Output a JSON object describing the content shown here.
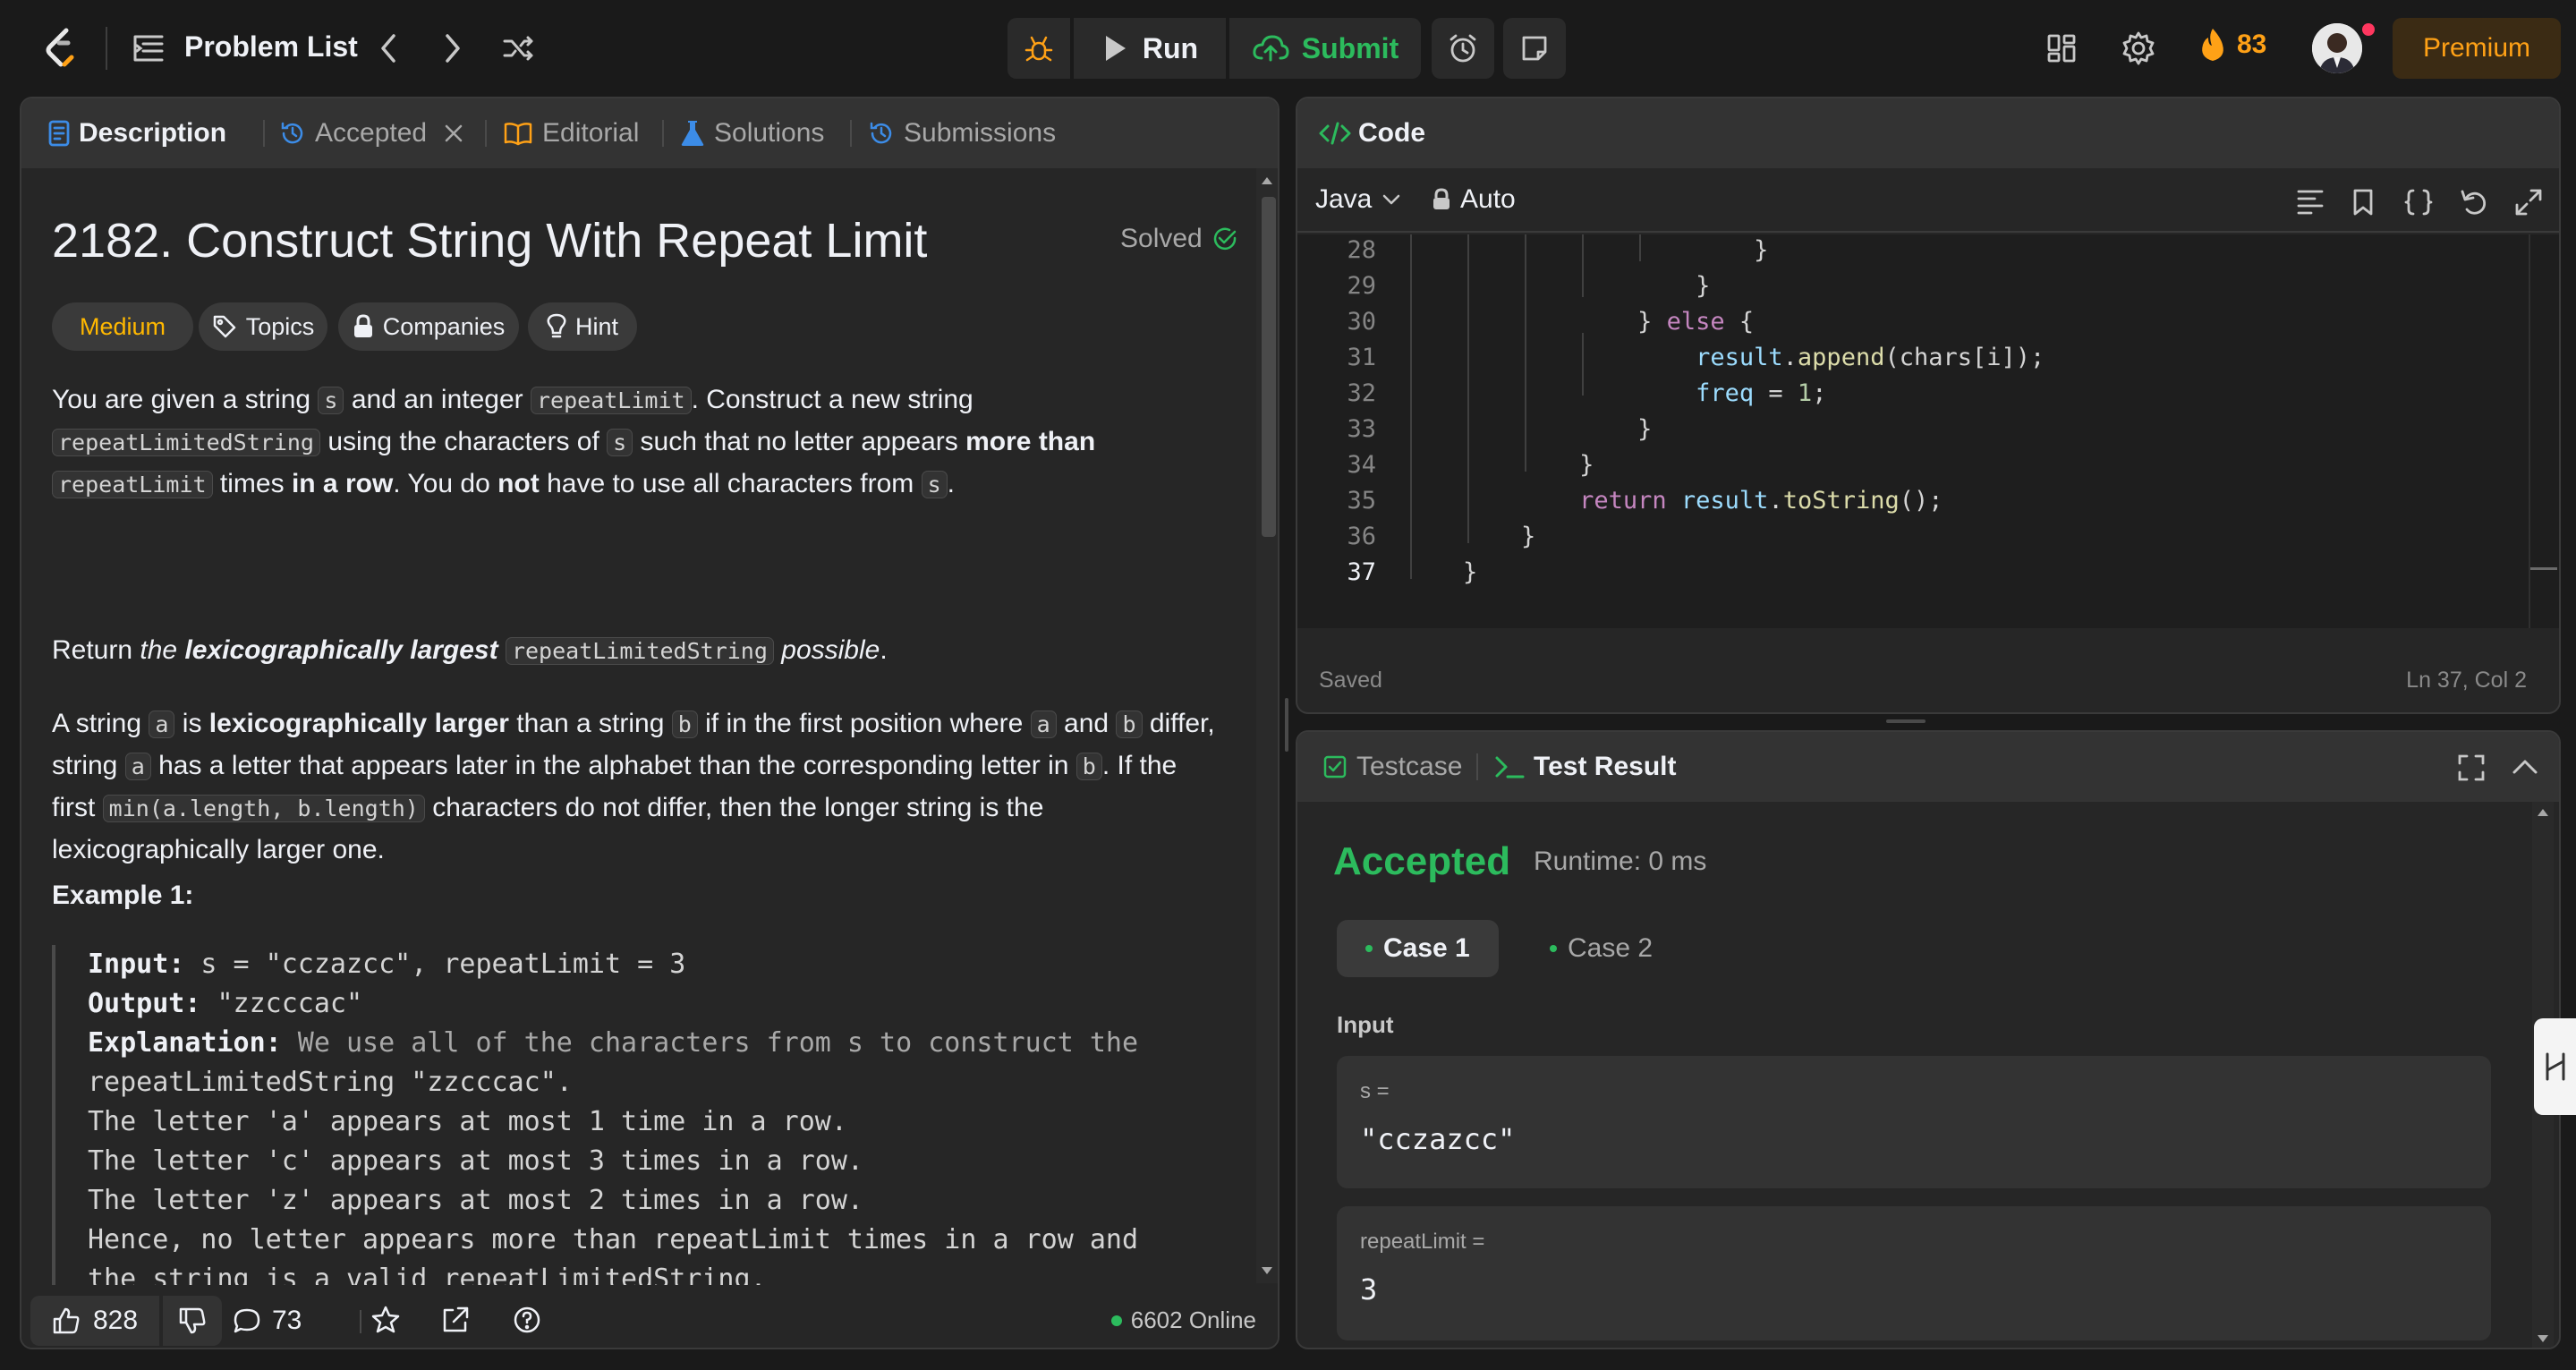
{
  "topbar": {
    "problem_list_label": "Problem List",
    "run_label": "Run",
    "submit_label": "Submit",
    "streak_count": "83",
    "premium_label": "Premium",
    "colors": {
      "brand": "#ffa116",
      "submit": "#2cbb5d",
      "bg": "#1a1a1a"
    },
    "icons": [
      "logo-icon",
      "list-icon",
      "chevron-left-icon",
      "chevron-right-icon",
      "shuffle-icon",
      "debug-icon",
      "play-icon",
      "cloud-upload-icon",
      "alarm-icon",
      "note-icon",
      "layout-icon",
      "gear-icon",
      "fire-icon",
      "avatar"
    ]
  },
  "left_tabs": [
    {
      "label": "Description",
      "icon": "document-icon"
    },
    {
      "label": "Accepted",
      "icon": "history-icon"
    },
    {
      "label": "Editorial",
      "icon": "book-icon"
    },
    {
      "label": "Solutions",
      "icon": "flask-icon"
    },
    {
      "label": "Submissions",
      "icon": "history-icon"
    }
  ],
  "problem": {
    "title": "2182. Construct String With Repeat Limit",
    "status": "Solved",
    "difficulty": "Medium",
    "tags": [
      "Topics",
      "Companies",
      "Hint"
    ],
    "p1": {
      "t1": "You are given a string ",
      "c1": "s",
      "t2": " and an integer ",
      "c2": "repeatLimit",
      "t3": ". Construct a new string ",
      "c3": "repeatLimitedString",
      "t4": " using the characters of ",
      "c4": "s",
      "t5": " such that no letter appears ",
      "b1": "more than",
      "t6": " ",
      "c5": "repeatLimit",
      "t7": " times ",
      "b2": "in a row",
      "t8": ". You do ",
      "b3": "not",
      "t9": " have to use all characters from ",
      "c6": "s",
      "t10": "."
    },
    "p2": {
      "t1": "Return ",
      "i1": "the ",
      "bi1": "lexicographically largest",
      "t2": " ",
      "c1": "repeatLimitedString",
      "i2": " possible",
      "t3": "."
    },
    "p3": {
      "t1": "A string ",
      "c1": "a",
      "t2": " is ",
      "b1": "lexicographically larger",
      "t3": " than a string ",
      "c2": "b",
      "t4": " if in the first position where ",
      "c3": "a",
      "t5": " and ",
      "c4": "b",
      "t6": " differ, string ",
      "c5": "a",
      "t7": " has a letter that appears later in the alphabet than the corresponding letter in ",
      "c6": "b",
      "t8": ". If the first ",
      "c7": "min(a.length, b.length)",
      "t9": " characters do not differ, then the longer string is the lexicographically larger one."
    },
    "example_title": "Example 1:",
    "example": {
      "input_key": "Input:",
      "input_val": " s = \"cczazcc\", repeatLimit = 3",
      "output_key": "Output:",
      "output_val": " \"zzcccac\"",
      "expl_key": "Explanation:",
      "expl_val": " We use all of the characters from s to construct the",
      "lines": [
        "repeatLimitedString \"zzcccac\".",
        "The letter 'a' appears at most 1 time in a row.",
        "The letter 'c' appears at most 3 times in a row.",
        "The letter 'z' appears at most 2 times in a row.",
        "Hence, no letter appears more than repeatLimit times in a row and",
        "the string is a valid repeatLimitedString."
      ]
    }
  },
  "footer": {
    "likes": "828",
    "comments": "73",
    "online": "6602 Online"
  },
  "code_panel": {
    "tab_label": "Code",
    "language": "Java",
    "mode": "Auto",
    "saved_label": "Saved",
    "cursor_position": "Ln 37, Col 2",
    "lines": [
      {
        "n": "28",
        "segs": [
          [
            "",
            "                        }"
          ]
        ]
      },
      {
        "n": "29",
        "segs": [
          [
            "",
            "                    }"
          ]
        ]
      },
      {
        "n": "30",
        "segs": [
          [
            "",
            "                } "
          ],
          [
            "kw",
            "else"
          ],
          [
            "",
            " {"
          ]
        ]
      },
      {
        "n": "31",
        "segs": [
          [
            "",
            "                    "
          ],
          [
            "vr",
            "result"
          ],
          [
            "",
            "."
          ],
          [
            "fn",
            "append"
          ],
          [
            "",
            "(chars[i]);"
          ]
        ]
      },
      {
        "n": "32",
        "segs": [
          [
            "",
            "                    "
          ],
          [
            "vr",
            "freq"
          ],
          [
            "",
            " = "
          ],
          [
            "nm",
            "1"
          ],
          [
            "",
            ";"
          ]
        ]
      },
      {
        "n": "33",
        "segs": [
          [
            "",
            "                }"
          ]
        ]
      },
      {
        "n": "34",
        "segs": [
          [
            "",
            "            }"
          ]
        ]
      },
      {
        "n": "35",
        "segs": [
          [
            "",
            "            "
          ],
          [
            "kw",
            "return"
          ],
          [
            "",
            " "
          ],
          [
            "vr",
            "result"
          ],
          [
            "",
            "."
          ],
          [
            "fn",
            "toString"
          ],
          [
            "",
            "();"
          ]
        ]
      },
      {
        "n": "36",
        "segs": [
          [
            "",
            "        }"
          ]
        ]
      },
      {
        "n": "37",
        "segs": [
          [
            "",
            "    }"
          ]
        ]
      }
    ]
  },
  "test_panel": {
    "tab_testcase": "Testcase",
    "tab_result": "Test Result",
    "verdict": "Accepted",
    "runtime": "Runtime: 0 ms",
    "cases": [
      "Case 1",
      "Case 2"
    ],
    "input_label": "Input",
    "vars": [
      {
        "name": "s =",
        "value": "\"cczazcc\""
      },
      {
        "name": "repeatLimit =",
        "value": "3"
      }
    ]
  }
}
